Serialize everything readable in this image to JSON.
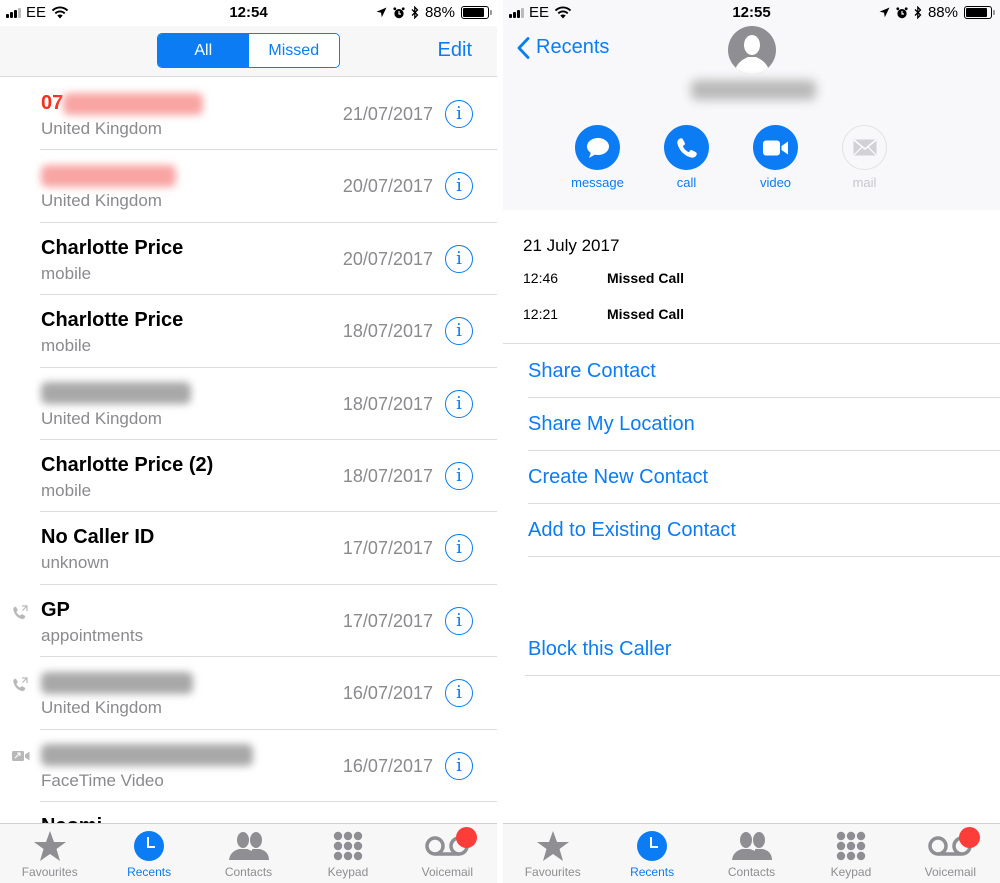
{
  "colors": {
    "accent": "#0b7cf4",
    "missed": "#fb2b1d",
    "secondary_text": "#8a8a8f",
    "badge": "#fc3d39"
  },
  "left_screen": {
    "status_bar": {
      "carrier": "EE",
      "time": "12:54",
      "battery": "88%",
      "battery_level": 0.88,
      "icons": [
        "signal-icon",
        "wifi-icon",
        "location-icon",
        "alarm-icon",
        "bluetooth-icon",
        "battery-icon"
      ]
    },
    "nav": {
      "segments": [
        {
          "label": "All",
          "selected": true
        },
        {
          "label": "Missed",
          "selected": false
        }
      ],
      "edit_label": "Edit"
    },
    "calls": [
      {
        "name_prefix": "07",
        "name_redacted": true,
        "missed": true,
        "subtitle": "United Kingdom",
        "date": "21/07/2017",
        "type_icon": ""
      },
      {
        "name_prefix": "",
        "name_redacted": true,
        "missed": true,
        "subtitle": "United Kingdom",
        "date": "20/07/2017",
        "type_icon": ""
      },
      {
        "name": "Charlotte Price",
        "missed": false,
        "subtitle": "mobile",
        "date": "20/07/2017",
        "type_icon": ""
      },
      {
        "name": "Charlotte Price",
        "missed": false,
        "subtitle": "mobile",
        "date": "18/07/2017",
        "type_icon": ""
      },
      {
        "name_prefix": "",
        "name_redacted": true,
        "missed": false,
        "subtitle": "United Kingdom",
        "date": "18/07/2017",
        "type_icon": ""
      },
      {
        "name": "Charlotte Price (2)",
        "missed": false,
        "subtitle": "mobile",
        "date": "18/07/2017",
        "type_icon": ""
      },
      {
        "name": "No Caller ID",
        "missed": false,
        "subtitle": "unknown",
        "date": "17/07/2017",
        "type_icon": ""
      },
      {
        "name": "GP",
        "missed": false,
        "subtitle": "appointments",
        "date": "17/07/2017",
        "type_icon": "outgoing-call-icon"
      },
      {
        "name_prefix": "",
        "name_redacted": true,
        "missed": false,
        "subtitle": "United Kingdom",
        "date": "16/07/2017",
        "type_icon": "outgoing-call-icon"
      },
      {
        "name_prefix": "",
        "name_redacted": true,
        "missed": false,
        "subtitle": "FaceTime Video",
        "date": "16/07/2017",
        "type_icon": "facetime-video-icon"
      }
    ],
    "partial_row_name": "Naomi",
    "info_glyph": "i",
    "tabs": [
      {
        "label": "Favourites",
        "icon": "star-icon",
        "active": false
      },
      {
        "label": "Recents",
        "icon": "clock-icon",
        "active": true
      },
      {
        "label": "Contacts",
        "icon": "contacts-icon",
        "active": false
      },
      {
        "label": "Keypad",
        "icon": "keypad-icon",
        "active": false
      },
      {
        "label": "Voicemail",
        "icon": "voicemail-icon",
        "active": false,
        "badge": true
      }
    ]
  },
  "right_screen": {
    "status_bar": {
      "carrier": "EE",
      "time": "12:55",
      "battery": "88%",
      "battery_level": 0.88
    },
    "back_label": "Recents",
    "contact_name_redacted": true,
    "actions": [
      {
        "label": "message",
        "icon": "message-icon",
        "enabled": true
      },
      {
        "label": "call",
        "icon": "phone-icon",
        "enabled": true
      },
      {
        "label": "video",
        "icon": "video-icon",
        "enabled": true
      },
      {
        "label": "mail",
        "icon": "mail-icon",
        "enabled": false
      }
    ],
    "history": {
      "date": "21 July 2017",
      "entries": [
        {
          "time": "12:46",
          "type": "Missed Call"
        },
        {
          "time": "12:21",
          "type": "Missed Call"
        }
      ]
    },
    "options": [
      "Share Contact",
      "Share My Location",
      "Create New Contact",
      "Add to Existing Contact"
    ],
    "block_label": "Block this Caller",
    "tabs": [
      {
        "label": "Favourites",
        "icon": "star-icon",
        "active": false
      },
      {
        "label": "Recents",
        "icon": "clock-icon",
        "active": true
      },
      {
        "label": "Contacts",
        "icon": "contacts-icon",
        "active": false
      },
      {
        "label": "Keypad",
        "icon": "keypad-icon",
        "active": false
      },
      {
        "label": "Voicemail",
        "icon": "voicemail-icon",
        "active": false,
        "badge": true
      }
    ]
  }
}
